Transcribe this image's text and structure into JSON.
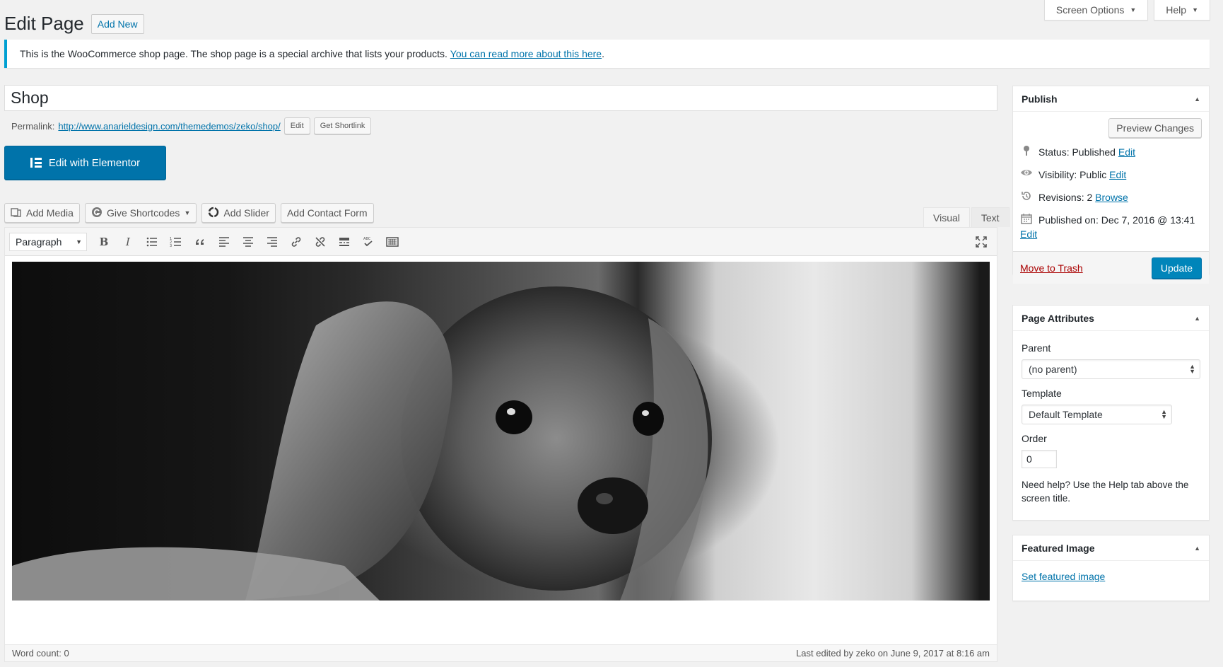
{
  "screen_tabs": {
    "screen_options": "Screen Options",
    "help": "Help"
  },
  "header": {
    "title": "Edit Page",
    "add_new": "Add New"
  },
  "notice": {
    "text": "This is the WooCommerce shop page. The shop page is a special archive that lists your products. ",
    "link": "You can read more about this here",
    "end": "."
  },
  "post": {
    "title": "Shop",
    "permalink_label": "Permalink:",
    "permalink_url": "http://www.anarieldesign.com/themedemos/zeko/shop/",
    "edit_btn": "Edit",
    "shortlink_btn": "Get Shortlink"
  },
  "elementor": {
    "label": "Edit with Elementor"
  },
  "media_buttons": {
    "add_media": "Add Media",
    "give_shortcodes": "Give Shortcodes",
    "add_slider": "Add Slider",
    "add_contact_form": "Add Contact Form"
  },
  "editor_tabs": {
    "visual": "Visual",
    "text": "Text"
  },
  "toolbar": {
    "format": "Paragraph",
    "bold": "B",
    "italic": "I"
  },
  "status_bar": {
    "word_count": "Word count: 0",
    "last_edited": "Last edited by zeko on June 9, 2017 at 8:16 am"
  },
  "publish": {
    "title": "Publish",
    "preview": "Preview Changes",
    "status_label": "Status: Published",
    "visibility_label": "Visibility: Public",
    "revisions_label": "Revisions: 2",
    "browse": "Browse",
    "published_on": "Published on: Dec 7, 2016 @ 13:41",
    "edit": "Edit",
    "trash": "Move to Trash",
    "update": "Update"
  },
  "page_attributes": {
    "title": "Page Attributes",
    "parent_label": "Parent",
    "parent_value": "(no parent)",
    "template_label": "Template",
    "template_value": "Default Template",
    "order_label": "Order",
    "order_value": "0",
    "help": "Need help? Use the Help tab above the screen title."
  },
  "featured_image": {
    "title": "Featured Image",
    "link": "Set featured image"
  },
  "colors": {
    "primary": "#0073aa",
    "update": "#0085ba",
    "trash": "#a00000",
    "notice_border": "#00a0d2"
  }
}
